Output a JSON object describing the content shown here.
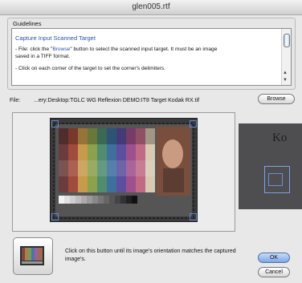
{
  "window": {
    "title": "glen005.rtf"
  },
  "guidelines": {
    "group_label": "Guidelines",
    "heading": "Capture Input Scanned Target",
    "line1_pre": "- File: click the \"",
    "line1_link": "Browse",
    "line1_post": "\" button to select the scanned input target. It must be an image",
    "line2": "saved in a TIFF format.",
    "line3": "- Click on each corner of the target to set the corner's delimiters."
  },
  "file": {
    "label": "File:",
    "path": "...ery:Desktop:TGLC WG Reflexion DEMO:IT8 Target Kodak RX.tif",
    "browse_label": "Browse"
  },
  "zoom": {
    "text": "Ko"
  },
  "orientation": {
    "instruction": "Click on this button until its image's orientation matches the captured image's."
  },
  "buttons": {
    "ok": "OK",
    "cancel": "Cancel"
  },
  "colors": {
    "accent": "#2e4fb5",
    "handle": "#5f86d8"
  }
}
